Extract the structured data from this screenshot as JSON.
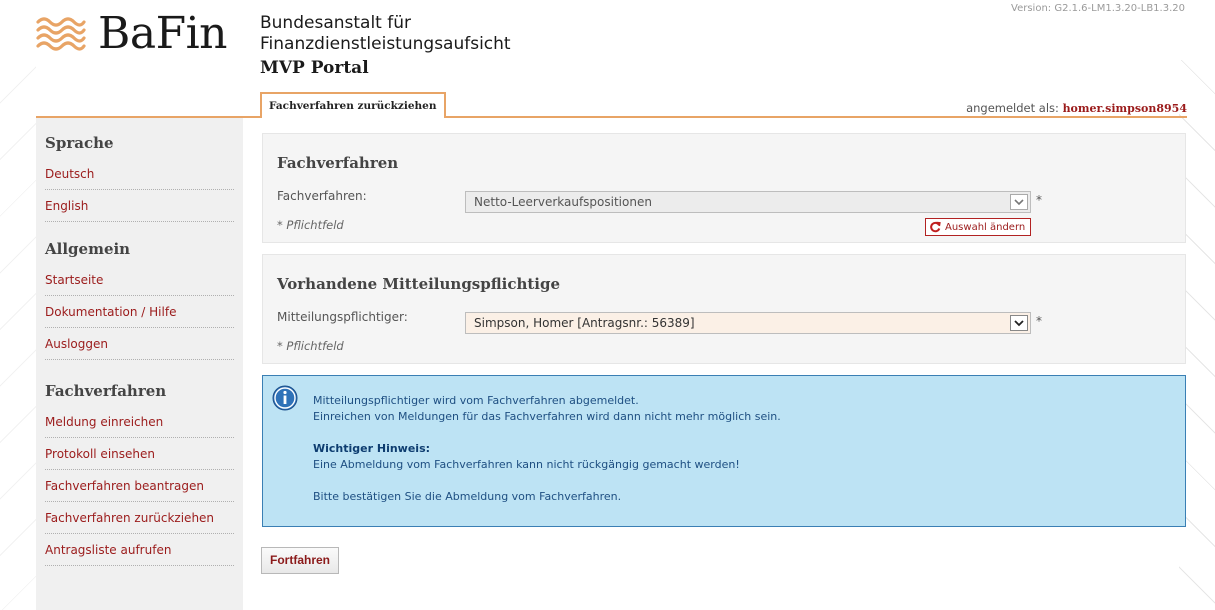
{
  "header": {
    "logo_text": "BaFin",
    "org_line1": "Bundesanstalt für",
    "org_line2": "Finanzdienstleistungsaufsicht",
    "portal": "MVP Portal",
    "version": "Version: G2.1.6-LM1.3.20-LB1.3.20"
  },
  "tab": {
    "label": "Fachverfahren zurückziehen"
  },
  "user": {
    "prefix": "angemeldet als:",
    "name": "homer.simpson8954"
  },
  "sidebar": {
    "sections": [
      {
        "heading": "Sprache",
        "items": [
          "Deutsch",
          "English"
        ]
      },
      {
        "heading": "Allgemein",
        "items": [
          "Startseite",
          "Dokumentation / Hilfe",
          "Ausloggen"
        ]
      },
      {
        "heading": "Fachverfahren",
        "items": [
          "Meldung einreichen",
          "Protokoll einsehen",
          "Fachverfahren beantragen",
          "Fachverfahren zurückziehen",
          "Antragsliste aufrufen"
        ]
      }
    ]
  },
  "panel1": {
    "title": "Fachverfahren",
    "label": "Fachverfahren:",
    "value": "Netto-Leerverkaufspositionen",
    "required_star": "*",
    "note": "* Pflichtfeld",
    "change_button": "Auswahl ändern"
  },
  "panel2": {
    "title": "Vorhandene Mitteilungspflichtige",
    "label": "Mitteilungspflichtiger:",
    "value": "Simpson, Homer [Antragsnr.: 56389]",
    "required_star": "*",
    "note": "* Pflichtfeld"
  },
  "info": {
    "line1": "Mitteilungspflichtiger wird vom Fachverfahren abgemeldet.",
    "line2": "Einreichen von Meldungen für das Fachverfahren wird dann nicht mehr möglich sein.",
    "important_heading": "Wichtiger Hinweis:",
    "important_text": "Eine Abmeldung vom Fachverfahren kann nicht rückgängig gemacht werden!",
    "confirm": "Bitte bestätigen Sie die Abmeldung vom Fachverfahren."
  },
  "continue_button": "Fortfahren",
  "colors": {
    "accent_orange": "#e8a466",
    "link_red": "#9b1b1b",
    "info_bg": "#bde3f4",
    "info_border": "#3a7fb4"
  }
}
